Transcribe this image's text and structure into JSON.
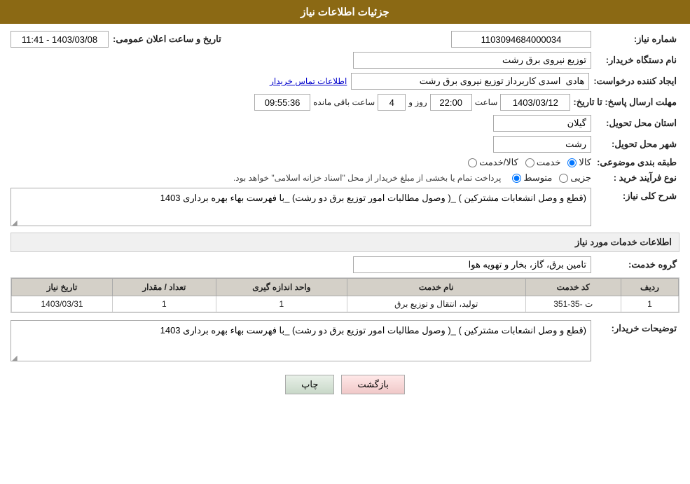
{
  "header": {
    "title": "جزئیات اطلاعات نیاز"
  },
  "form": {
    "needNumber_label": "شماره نیاز:",
    "needNumber_value": "1103094684000034",
    "announceDateTime_label": "تاریخ و ساعت اعلان عمومی:",
    "announceDateTime_value": "1403/03/08 - 11:41",
    "buyerOrg_label": "نام دستگاه خریدار:",
    "buyerOrg_value": "توزیع نیروی برق رشت",
    "creator_label": "ایجاد کننده درخواست:",
    "creator_value": "هادی  اسدی کاربرداز توزیع نیروی برق رشت",
    "contactInfo_link": "اطلاعات تماس خریدار",
    "deadline_label": "مهلت ارسال پاسخ: تا تاریخ:",
    "deadline_date": "1403/03/12",
    "deadline_time_label": "ساعت",
    "deadline_time": "22:00",
    "deadline_days_label": "روز و",
    "deadline_days": "4",
    "deadline_remaining_label": "ساعت باقی مانده",
    "deadline_remaining": "09:55:36",
    "province_label": "استان محل تحویل:",
    "province_value": "گیلان",
    "city_label": "شهر محل تحویل:",
    "city_value": "رشت",
    "category_label": "طبقه بندی موضوعی:",
    "category_kala": "کالا",
    "category_khadamat": "خدمت",
    "category_kala_khadamat": "کالا/خدمت",
    "purchase_type_label": "نوع فرآیند خرید :",
    "purchase_jozvi": "جزیی",
    "purchase_motavasset": "متوسط",
    "purchase_note": "پرداخت تمام یا بخشی از مبلغ خریدار از محل \"اسناد خزانه اسلامی\" خواهد بود.",
    "needDescription_label": "شرح کلی نیاز:",
    "needDescription_value": "(قطع و وصل انشعابات مشترکین ) _( وصول مطالبات امور توزیع برق دو رشت) _با فهرست بهاء بهره برداری 1403",
    "serviceInfo_title": "اطلاعات خدمات مورد نیاز",
    "serviceGroup_label": "گروه خدمت:",
    "serviceGroup_value": "تامین برق، گاز، بخار و تهویه هوا",
    "table": {
      "headers": [
        "ردیف",
        "کد خدمت",
        "نام خدمت",
        "واحد اندازه گیری",
        "تعداد / مقدار",
        "تاریخ نیاز"
      ],
      "rows": [
        [
          "1",
          "ت -35-351",
          "تولید، انتقال و توزیع برق",
          "1",
          "1",
          "1403/03/31"
        ]
      ]
    },
    "buyerNotes_label": "توضیحات خریدار:",
    "buyerNotes_value": "(قطع و وصل انشعابات مشترکین ) _( وصول مطالبات امور توزیع برق دو رشت) _با فهرست بهاء بهره برداری 1403",
    "btn_print": "چاپ",
    "btn_back": "بازگشت"
  }
}
